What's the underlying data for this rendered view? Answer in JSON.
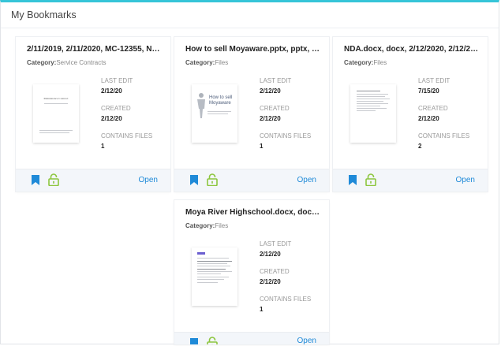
{
  "panel": {
    "title": "My Bookmarks"
  },
  "labels": {
    "category": "Category:",
    "last_edit": "LAST EDIT",
    "created": "CREATED",
    "contains_files": "CONTAINS FILES",
    "open": "Open"
  },
  "cards": [
    {
      "title": "2/11/2019, 2/11/2020, MC-12355, Ne...",
      "category": "Service Contracts",
      "last_edit": "2/12/20",
      "created": "2/12/20",
      "contains_files": "1",
      "thumb_heading": "Maintenance Contract"
    },
    {
      "title": "How to sell Moyaware.pptx, pptx, 2...",
      "category": "Files",
      "last_edit": "2/12/20",
      "created": "2/12/20",
      "contains_files": "1",
      "thumb_heading": "How to sell Moyaware"
    },
    {
      "title": "NDA.docx, docx, 2/12/2020, 2/12/20...",
      "category": "Files",
      "last_edit": "7/15/20",
      "created": "2/12/20",
      "contains_files": "2"
    },
    {
      "title": "Moya River Highschool.docx, docx, ...",
      "category": "Files",
      "last_edit": "2/12/20",
      "created": "2/12/20",
      "contains_files": "1"
    }
  ],
  "colors": {
    "accent": "#36c5d8",
    "bookmark": "#1f8ad8",
    "lock": "#8dc63f",
    "link": "#1f8ad8"
  },
  "icons": {
    "bookmark": "bookmark-icon",
    "lock": "unlock-icon"
  }
}
